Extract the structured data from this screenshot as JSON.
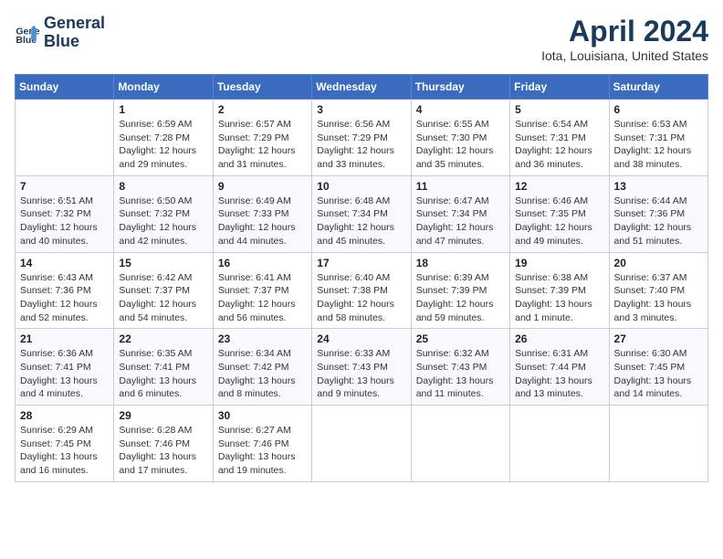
{
  "header": {
    "logo_line1": "General",
    "logo_line2": "Blue",
    "month_title": "April 2024",
    "location": "Iota, Louisiana, United States"
  },
  "days_of_week": [
    "Sunday",
    "Monday",
    "Tuesday",
    "Wednesday",
    "Thursday",
    "Friday",
    "Saturday"
  ],
  "weeks": [
    [
      {
        "day": "",
        "info": ""
      },
      {
        "day": "1",
        "info": "Sunrise: 6:59 AM\nSunset: 7:28 PM\nDaylight: 12 hours\nand 29 minutes."
      },
      {
        "day": "2",
        "info": "Sunrise: 6:57 AM\nSunset: 7:29 PM\nDaylight: 12 hours\nand 31 minutes."
      },
      {
        "day": "3",
        "info": "Sunrise: 6:56 AM\nSunset: 7:29 PM\nDaylight: 12 hours\nand 33 minutes."
      },
      {
        "day": "4",
        "info": "Sunrise: 6:55 AM\nSunset: 7:30 PM\nDaylight: 12 hours\nand 35 minutes."
      },
      {
        "day": "5",
        "info": "Sunrise: 6:54 AM\nSunset: 7:31 PM\nDaylight: 12 hours\nand 36 minutes."
      },
      {
        "day": "6",
        "info": "Sunrise: 6:53 AM\nSunset: 7:31 PM\nDaylight: 12 hours\nand 38 minutes."
      }
    ],
    [
      {
        "day": "7",
        "info": "Sunrise: 6:51 AM\nSunset: 7:32 PM\nDaylight: 12 hours\nand 40 minutes."
      },
      {
        "day": "8",
        "info": "Sunrise: 6:50 AM\nSunset: 7:32 PM\nDaylight: 12 hours\nand 42 minutes."
      },
      {
        "day": "9",
        "info": "Sunrise: 6:49 AM\nSunset: 7:33 PM\nDaylight: 12 hours\nand 44 minutes."
      },
      {
        "day": "10",
        "info": "Sunrise: 6:48 AM\nSunset: 7:34 PM\nDaylight: 12 hours\nand 45 minutes."
      },
      {
        "day": "11",
        "info": "Sunrise: 6:47 AM\nSunset: 7:34 PM\nDaylight: 12 hours\nand 47 minutes."
      },
      {
        "day": "12",
        "info": "Sunrise: 6:46 AM\nSunset: 7:35 PM\nDaylight: 12 hours\nand 49 minutes."
      },
      {
        "day": "13",
        "info": "Sunrise: 6:44 AM\nSunset: 7:36 PM\nDaylight: 12 hours\nand 51 minutes."
      }
    ],
    [
      {
        "day": "14",
        "info": "Sunrise: 6:43 AM\nSunset: 7:36 PM\nDaylight: 12 hours\nand 52 minutes."
      },
      {
        "day": "15",
        "info": "Sunrise: 6:42 AM\nSunset: 7:37 PM\nDaylight: 12 hours\nand 54 minutes."
      },
      {
        "day": "16",
        "info": "Sunrise: 6:41 AM\nSunset: 7:37 PM\nDaylight: 12 hours\nand 56 minutes."
      },
      {
        "day": "17",
        "info": "Sunrise: 6:40 AM\nSunset: 7:38 PM\nDaylight: 12 hours\nand 58 minutes."
      },
      {
        "day": "18",
        "info": "Sunrise: 6:39 AM\nSunset: 7:39 PM\nDaylight: 12 hours\nand 59 minutes."
      },
      {
        "day": "19",
        "info": "Sunrise: 6:38 AM\nSunset: 7:39 PM\nDaylight: 13 hours\nand 1 minute."
      },
      {
        "day": "20",
        "info": "Sunrise: 6:37 AM\nSunset: 7:40 PM\nDaylight: 13 hours\nand 3 minutes."
      }
    ],
    [
      {
        "day": "21",
        "info": "Sunrise: 6:36 AM\nSunset: 7:41 PM\nDaylight: 13 hours\nand 4 minutes."
      },
      {
        "day": "22",
        "info": "Sunrise: 6:35 AM\nSunset: 7:41 PM\nDaylight: 13 hours\nand 6 minutes."
      },
      {
        "day": "23",
        "info": "Sunrise: 6:34 AM\nSunset: 7:42 PM\nDaylight: 13 hours\nand 8 minutes."
      },
      {
        "day": "24",
        "info": "Sunrise: 6:33 AM\nSunset: 7:43 PM\nDaylight: 13 hours\nand 9 minutes."
      },
      {
        "day": "25",
        "info": "Sunrise: 6:32 AM\nSunset: 7:43 PM\nDaylight: 13 hours\nand 11 minutes."
      },
      {
        "day": "26",
        "info": "Sunrise: 6:31 AM\nSunset: 7:44 PM\nDaylight: 13 hours\nand 13 minutes."
      },
      {
        "day": "27",
        "info": "Sunrise: 6:30 AM\nSunset: 7:45 PM\nDaylight: 13 hours\nand 14 minutes."
      }
    ],
    [
      {
        "day": "28",
        "info": "Sunrise: 6:29 AM\nSunset: 7:45 PM\nDaylight: 13 hours\nand 16 minutes."
      },
      {
        "day": "29",
        "info": "Sunrise: 6:28 AM\nSunset: 7:46 PM\nDaylight: 13 hours\nand 17 minutes."
      },
      {
        "day": "30",
        "info": "Sunrise: 6:27 AM\nSunset: 7:46 PM\nDaylight: 13 hours\nand 19 minutes."
      },
      {
        "day": "",
        "info": ""
      },
      {
        "day": "",
        "info": ""
      },
      {
        "day": "",
        "info": ""
      },
      {
        "day": "",
        "info": ""
      }
    ]
  ]
}
